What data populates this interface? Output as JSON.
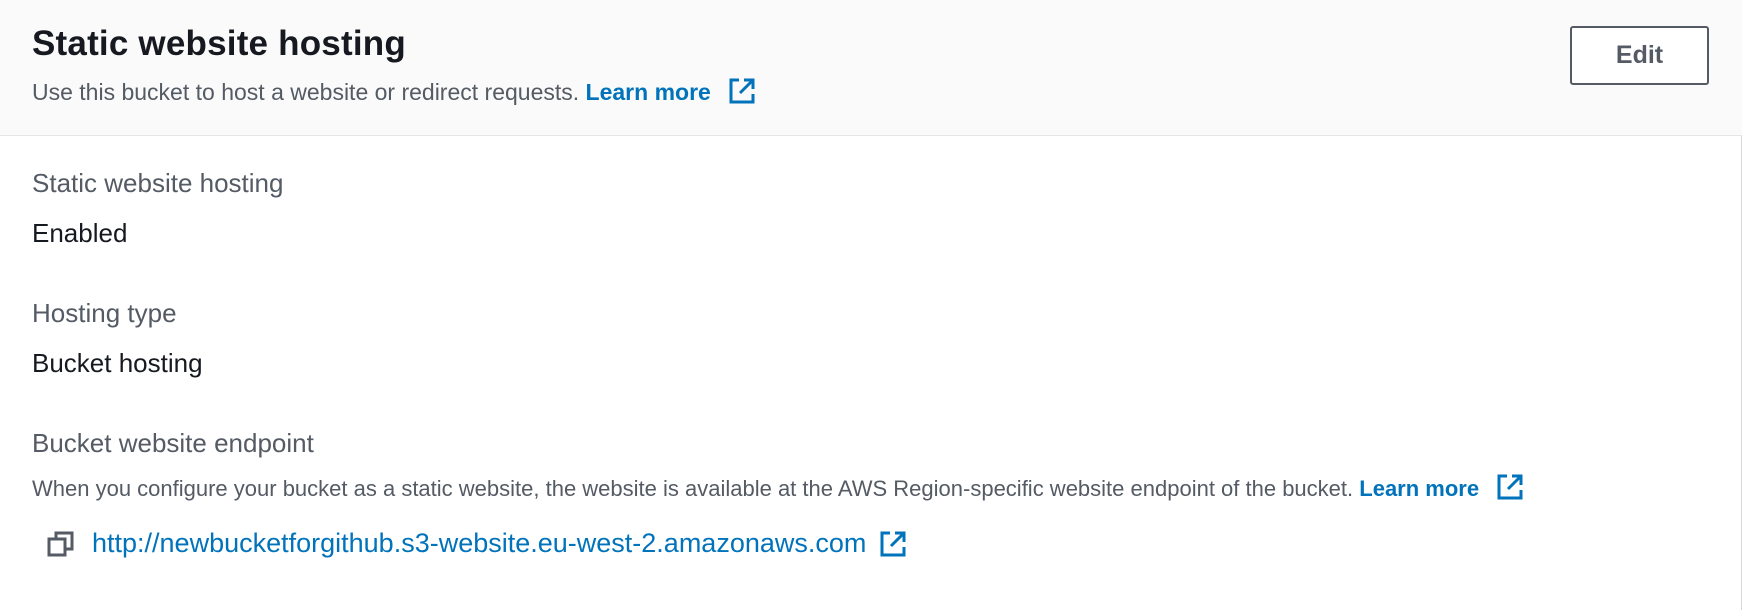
{
  "header": {
    "title": "Static website hosting",
    "description": "Use this bucket to host a website or redirect requests.",
    "learn_more": "Learn more",
    "edit_label": "Edit"
  },
  "fields": {
    "hosting": {
      "label": "Static website hosting",
      "value": "Enabled"
    },
    "type": {
      "label": "Hosting type",
      "value": "Bucket hosting"
    },
    "endpoint": {
      "label": "Bucket website endpoint",
      "description": "When you configure your bucket as a static website, the website is available at the AWS Region-specific website endpoint of the bucket.",
      "learn_more": "Learn more",
      "url": "http://newbucketforgithub.s3-website.eu-west-2.amazonaws.com"
    }
  },
  "icons": {
    "external_link": "external-link-icon",
    "copy": "copy-icon"
  },
  "colors": {
    "link": "#0073bb",
    "label": "#545b64",
    "text": "#16191f",
    "header_bg": "#fafafa"
  }
}
